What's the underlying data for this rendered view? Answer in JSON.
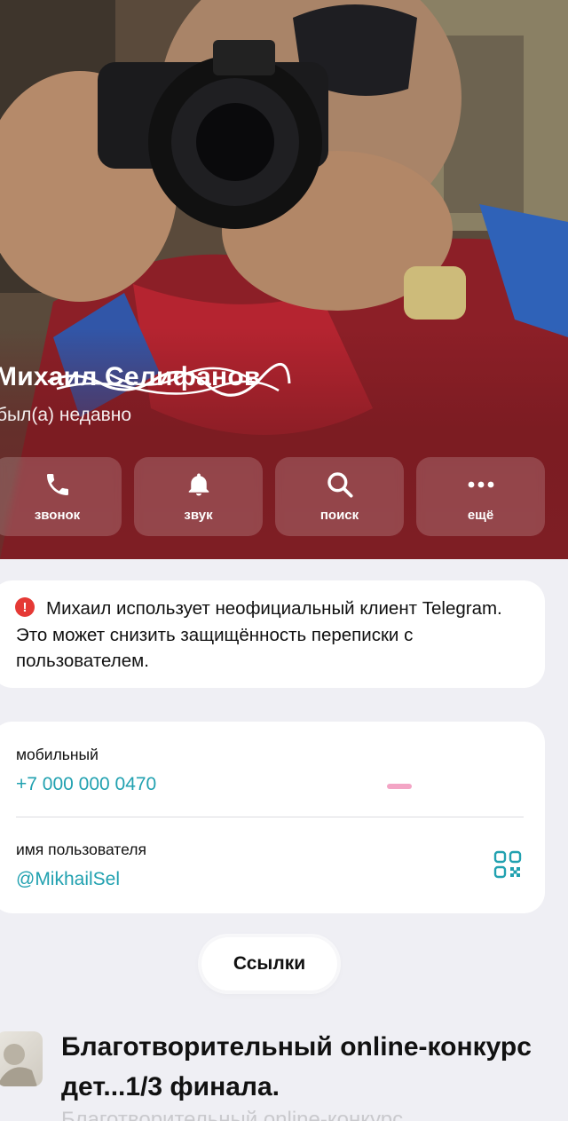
{
  "profile": {
    "name": "Михаил Селифанов",
    "status": "был(а) недавно"
  },
  "actions": [
    {
      "label": "звонок",
      "icon": "phone-icon"
    },
    {
      "label": "звук",
      "icon": "bell-icon"
    },
    {
      "label": "поиск",
      "icon": "search-icon"
    },
    {
      "label": "ещё",
      "icon": "more-icon"
    }
  ],
  "warning": {
    "icon": "exclamation-icon",
    "glyph": "!",
    "text": "Михаил использует неофициальный клиент Telegram. Это может снизить защищённость переписки с пользователем."
  },
  "info": {
    "phone_label": "мобильный",
    "phone_value": "+7 000 000 0470",
    "username_label": "имя пользователя",
    "username_value": "@MikhailSel"
  },
  "links_button": "Ссылки",
  "link_item": {
    "title": "Благотворительный online-конкурс дет...1/3 финала.",
    "description": "Благотворительный online-конкурс"
  },
  "colors": {
    "accent": "#21a1b0",
    "warning": "#e53935",
    "background": "#efeff4"
  }
}
